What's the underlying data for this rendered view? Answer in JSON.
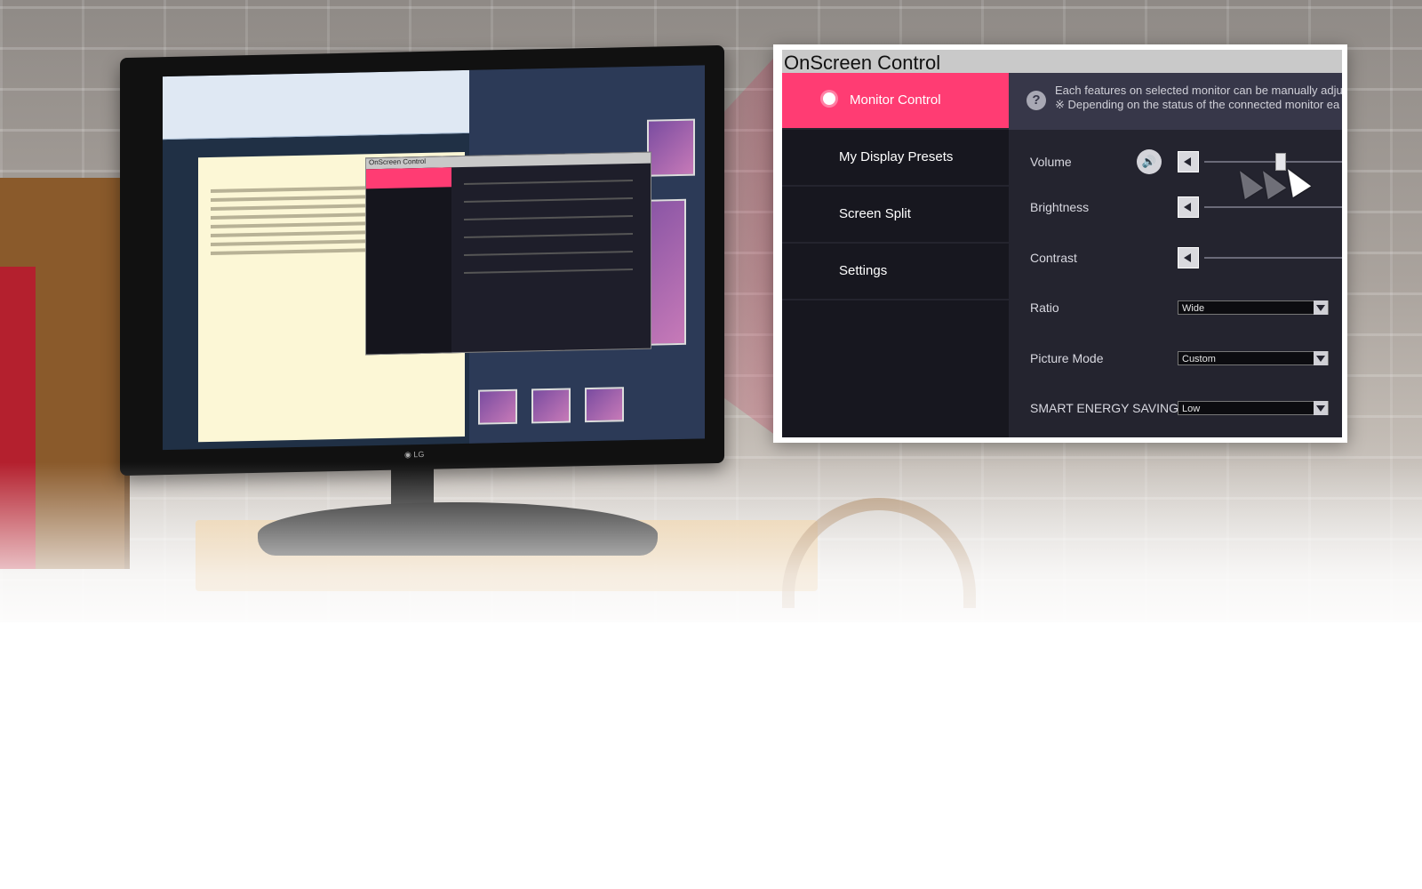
{
  "window": {
    "title": "OnScreen Control"
  },
  "sidebar": {
    "items": [
      {
        "label": "Monitor Control",
        "active": true
      },
      {
        "label": "My Display Presets",
        "active": false
      },
      {
        "label": "Screen Split",
        "active": false
      },
      {
        "label": "Settings",
        "active": false
      }
    ]
  },
  "info": {
    "line1": "Each features on selected monitor can be manually adjus",
    "line2": "※ Depending on the status of the connected monitor ea"
  },
  "controls": {
    "volume": {
      "label": "Volume"
    },
    "brightness": {
      "label": "Brightness"
    },
    "contrast": {
      "label": "Contrast"
    },
    "ratio": {
      "label": "Ratio",
      "value": "Wide"
    },
    "picture_mode": {
      "label": "Picture Mode",
      "value": "Custom"
    },
    "energy": {
      "label": "SMART ENERGY SAVING",
      "value": "Low"
    }
  },
  "colors": {
    "accent": "#ff3c73",
    "sidebar_bg": "#17171f",
    "main_bg": "#24242f"
  },
  "icons": [
    "radio-selected-icon",
    "help-icon",
    "speaker-icon",
    "left-arrow-icon",
    "dropdown-caret-icon",
    "mouse-cursor-icon"
  ]
}
